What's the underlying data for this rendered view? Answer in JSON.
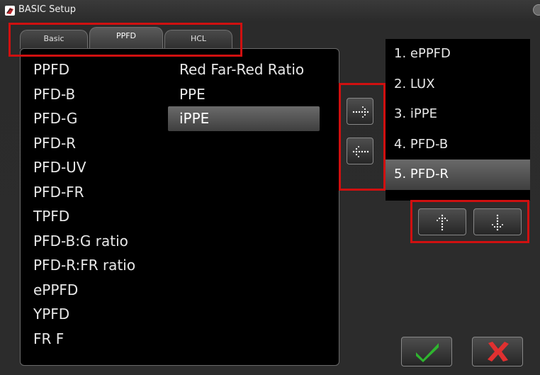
{
  "window": {
    "title": "BASIC Setup"
  },
  "tabs": [
    {
      "label": "Basic"
    },
    {
      "label": "PPFD"
    },
    {
      "label": "HCL"
    }
  ],
  "active_tab": "PPFD",
  "available": {
    "column1": [
      "PPFD",
      "PFD-B",
      "PFD-G",
      "PFD-R",
      "PFD-UV",
      "PFD-FR",
      "TPFD",
      "PFD-B:G ratio",
      "PFD-R:FR ratio",
      "ePPFD",
      "YPFD",
      "FR F"
    ],
    "column2": [
      "Red Far-Red Ratio",
      "PPE",
      "iPPE"
    ],
    "selected": "iPPE"
  },
  "selected_list": {
    "items": [
      "1. ePPFD",
      "2. LUX",
      "3. iPPE",
      "4. PFD-B",
      "5. PFD-R"
    ],
    "highlighted": "5. PFD-R"
  },
  "icons": {
    "app": "app-logo-icon",
    "add": "dotted-arrow-right-icon",
    "remove": "dotted-arrow-left-icon",
    "move_up": "dotted-arrow-up-icon",
    "move_down": "dotted-arrow-down-icon",
    "ok": "checkmark-icon",
    "cancel": "x-icon"
  },
  "colors": {
    "highlight_box": "#d01010",
    "ok_green": "#2fb52f",
    "cancel_red": "#e03030"
  }
}
